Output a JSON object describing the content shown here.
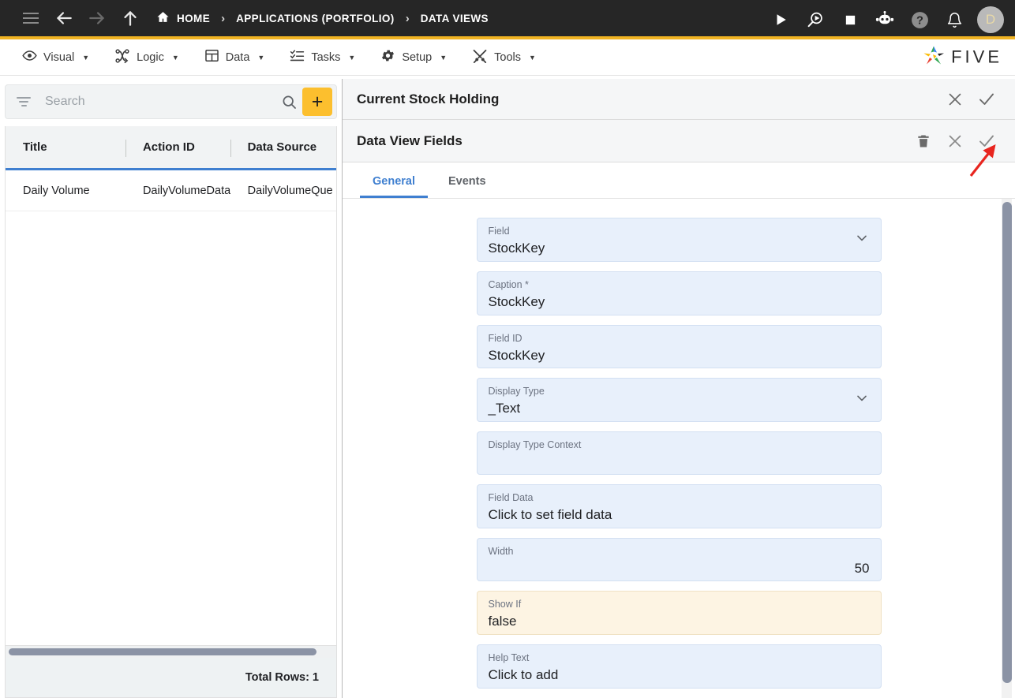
{
  "topbar": {
    "nav_icons": [
      {
        "name": "hamburger-menu-icon",
        "label": "menu"
      },
      {
        "name": "back-arrow-icon",
        "label": "back"
      },
      {
        "name": "forward-arrow-icon",
        "label": "forward"
      },
      {
        "name": "up-arrow-icon",
        "label": "up"
      }
    ],
    "breadcrumbs": [
      {
        "label": "HOME",
        "icon": "home-icon"
      },
      {
        "label": "APPLICATIONS (PORTFOLIO)",
        "icon": ""
      },
      {
        "label": "DATA VIEWS",
        "icon": ""
      }
    ],
    "separator": "›",
    "actions": [
      {
        "name": "run-icon",
        "label": "Run"
      },
      {
        "name": "debug-run-icon",
        "label": "Debug"
      },
      {
        "name": "stop-icon",
        "label": "Stop"
      },
      {
        "name": "assistant-bot-icon",
        "label": "Assistant"
      },
      {
        "name": "help-icon",
        "label": "Help"
      },
      {
        "name": "notifications-bell-icon",
        "label": "Notifications"
      }
    ],
    "avatar_initial": "D"
  },
  "menubar": {
    "items": [
      {
        "label": "Visual",
        "icon": "eye-icon"
      },
      {
        "label": "Logic",
        "icon": "logic-nodes-icon"
      },
      {
        "label": "Data",
        "icon": "table-icon"
      },
      {
        "label": "Tasks",
        "icon": "task-list-icon"
      },
      {
        "label": "Setup",
        "icon": "gear-icon"
      },
      {
        "label": "Tools",
        "icon": "tools-icon"
      }
    ],
    "caret": "▼",
    "brand": "FIVE"
  },
  "left_panel": {
    "search": {
      "placeholder": "Search",
      "value": "",
      "filter_icon": "filter-icon",
      "search_icon": "search-icon"
    },
    "add_button_label": "+",
    "grid": {
      "columns": [
        "Title",
        "Action ID",
        "Data Source"
      ],
      "rows": [
        [
          "Daily Volume",
          "DailyVolumeData…",
          "DailyVolumeQue"
        ]
      ]
    },
    "footer": "Total Rows: 1"
  },
  "right_panel": {
    "header": {
      "title": "Current Stock Holding",
      "buttons": [
        {
          "name": "close-icon",
          "label": "✕"
        },
        {
          "name": "confirm-check-icon",
          "label": "✓"
        }
      ]
    },
    "sub_header": {
      "title": "Data View Fields",
      "buttons": [
        {
          "name": "delete-trash-icon",
          "label": "delete"
        },
        {
          "name": "close-icon",
          "label": "✕"
        },
        {
          "name": "confirm-check-icon",
          "label": "✓"
        }
      ]
    },
    "tabs": [
      {
        "label": "General",
        "active": true
      },
      {
        "label": "Events",
        "active": false
      }
    ],
    "fields": [
      {
        "label": "Field",
        "value": "StockKey",
        "type": "select",
        "style": "normal",
        "align": "left"
      },
      {
        "label": "Caption *",
        "value": "StockKey",
        "type": "text",
        "style": "normal",
        "align": "left"
      },
      {
        "label": "Field ID",
        "value": "StockKey",
        "type": "text",
        "style": "normal",
        "align": "left"
      },
      {
        "label": "Display Type",
        "value": "_Text",
        "type": "select",
        "style": "normal",
        "align": "left"
      },
      {
        "label": "Display Type Context",
        "value": "",
        "type": "text",
        "style": "normal",
        "align": "left"
      },
      {
        "label": "Field Data",
        "value": "Click to set field data",
        "type": "text",
        "style": "normal",
        "align": "left"
      },
      {
        "label": "Width",
        "value": "50",
        "type": "text",
        "style": "normal",
        "align": "right"
      },
      {
        "label": "Show If",
        "value": "false",
        "type": "text",
        "style": "warn",
        "align": "left"
      },
      {
        "label": "Help Text",
        "value": "Click to add",
        "type": "text",
        "style": "normal",
        "align": "left"
      }
    ]
  },
  "annotation": {
    "arrow_color": "#e8251f",
    "points_to": "confirm-check-icon"
  },
  "colors": {
    "accent_yellow": "#f0b323",
    "add_button": "#fcbf2e",
    "tab_active": "#3f7fd0",
    "field_bg": "#e8f0fb",
    "field_warn_bg": "#fdf4e3",
    "topbar_bg": "#262626"
  }
}
